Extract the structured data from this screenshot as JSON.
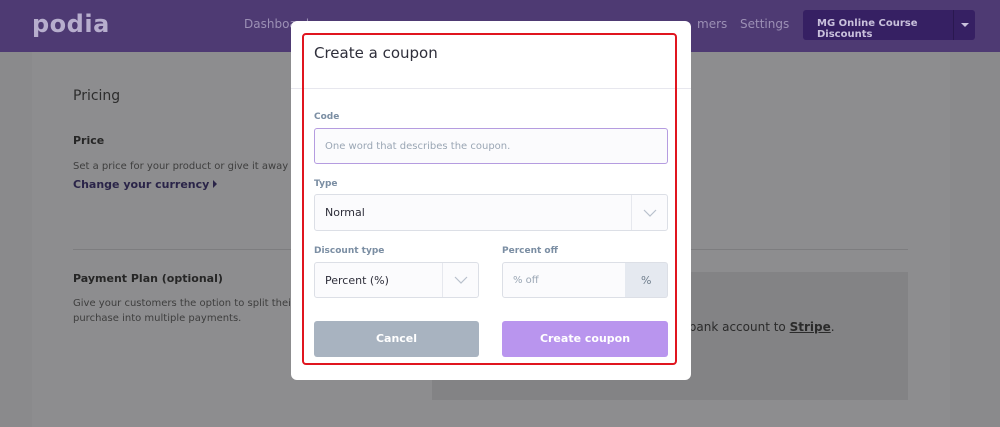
{
  "brand": {
    "logo": "podia"
  },
  "nav": {
    "items": [
      "Dashboard",
      "Settings"
    ],
    "partial_item": "mers",
    "store_button": "MG Online Course Discounts"
  },
  "background": {
    "section_title": "Pricing",
    "price_heading": "Price",
    "price_text": "Set a price for your product or give it away f",
    "currency_link": "Change your currency",
    "plan_heading": "Payment Plan (optional)",
    "plan_text_1": "Give your customers the option to split their",
    "plan_text_2": "purchase into multiple payments.",
    "stripe_text": "r bank account to",
    "stripe_link": "Stripe",
    "stripe_end": "."
  },
  "modal": {
    "title": "Create a coupon",
    "code": {
      "label": "Code",
      "placeholder": "One word that describes the coupon.",
      "value": ""
    },
    "type": {
      "label": "Type",
      "value": "Normal"
    },
    "discount_type": {
      "label": "Discount type",
      "value": "Percent (%)"
    },
    "percent_off": {
      "label": "Percent off",
      "placeholder": "% off",
      "suffix": "%"
    },
    "cancel_label": "Cancel",
    "create_label": "Create coupon"
  },
  "colors": {
    "topbar": "#4e3a73",
    "primary": "#b995ee",
    "cancel": "#a8b3c0",
    "highlight_outline": "#e0151f"
  }
}
